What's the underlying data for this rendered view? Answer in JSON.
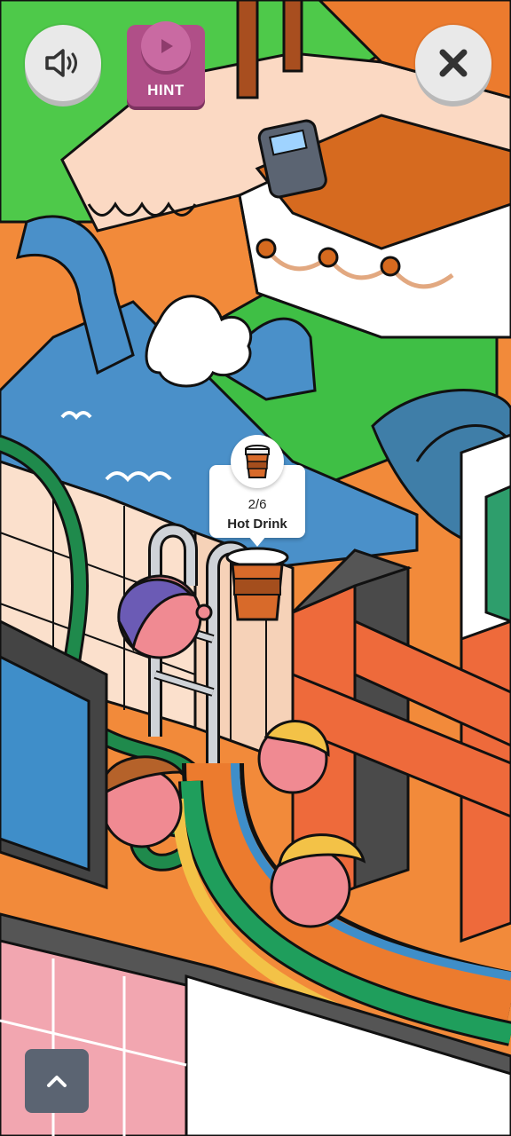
{
  "hud": {
    "sound_icon": "speaker-icon",
    "hint_label": "HINT",
    "hint_icon": "play-icon",
    "close_icon": "close-icon",
    "scroll_icon": "chevron-up-icon"
  },
  "target": {
    "progress": "2/6",
    "found": 2,
    "total": 6,
    "name": "Hot Drink",
    "icon": "coffee-cup-icon"
  },
  "colors": {
    "hint_bg": "#b04f88",
    "button_bg": "#e9e9e9",
    "scroll_btn_bg": "#5b6472",
    "grass": "#4ec94a",
    "water": "#4a90c9",
    "orange": "#f28a3a",
    "red_beam": "#ee6a3b"
  }
}
